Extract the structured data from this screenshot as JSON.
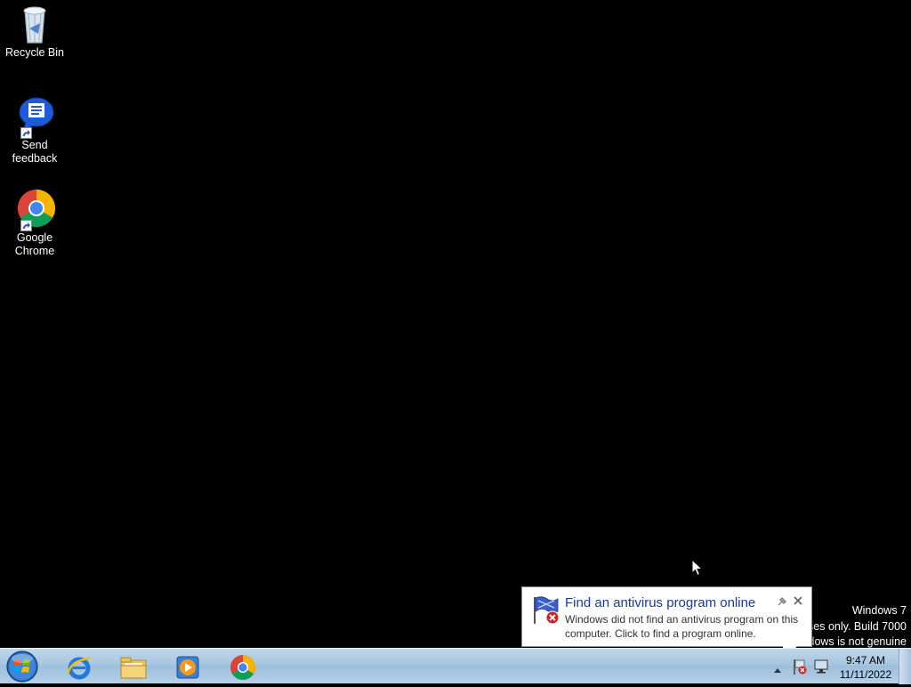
{
  "desktop": {
    "icons": [
      {
        "label": "Recycle Bin",
        "icon": "recycle-bin-icon"
      },
      {
        "label": "Send feedback",
        "icon": "feedback-bubble-icon"
      },
      {
        "label": "Google Chrome",
        "icon": "chrome-icon"
      }
    ],
    "watermark": {
      "line1": "Windows  7",
      "line2": "uses only. Build 7000",
      "line3": "dows is not genuine"
    }
  },
  "balloon": {
    "title": "Find an antivirus program online",
    "text": "Windows did not find an antivirus program on this computer. Click to find a program online.",
    "icon": "action-center-flag-icon"
  },
  "taskbar": {
    "pinned": [
      {
        "name": "internet-explorer",
        "icon": "internet-explorer-icon"
      },
      {
        "name": "windows-explorer",
        "icon": "folder-icon"
      },
      {
        "name": "media-player",
        "icon": "media-player-icon"
      },
      {
        "name": "google-chrome",
        "icon": "chrome-icon"
      }
    ],
    "clock": {
      "time": "9:47 AM",
      "date": "11/11/2022"
    }
  },
  "colors": {
    "desktop_bg": "#000000",
    "balloon_title": "#1b3a9a",
    "taskbar": "#a9c6e0"
  }
}
